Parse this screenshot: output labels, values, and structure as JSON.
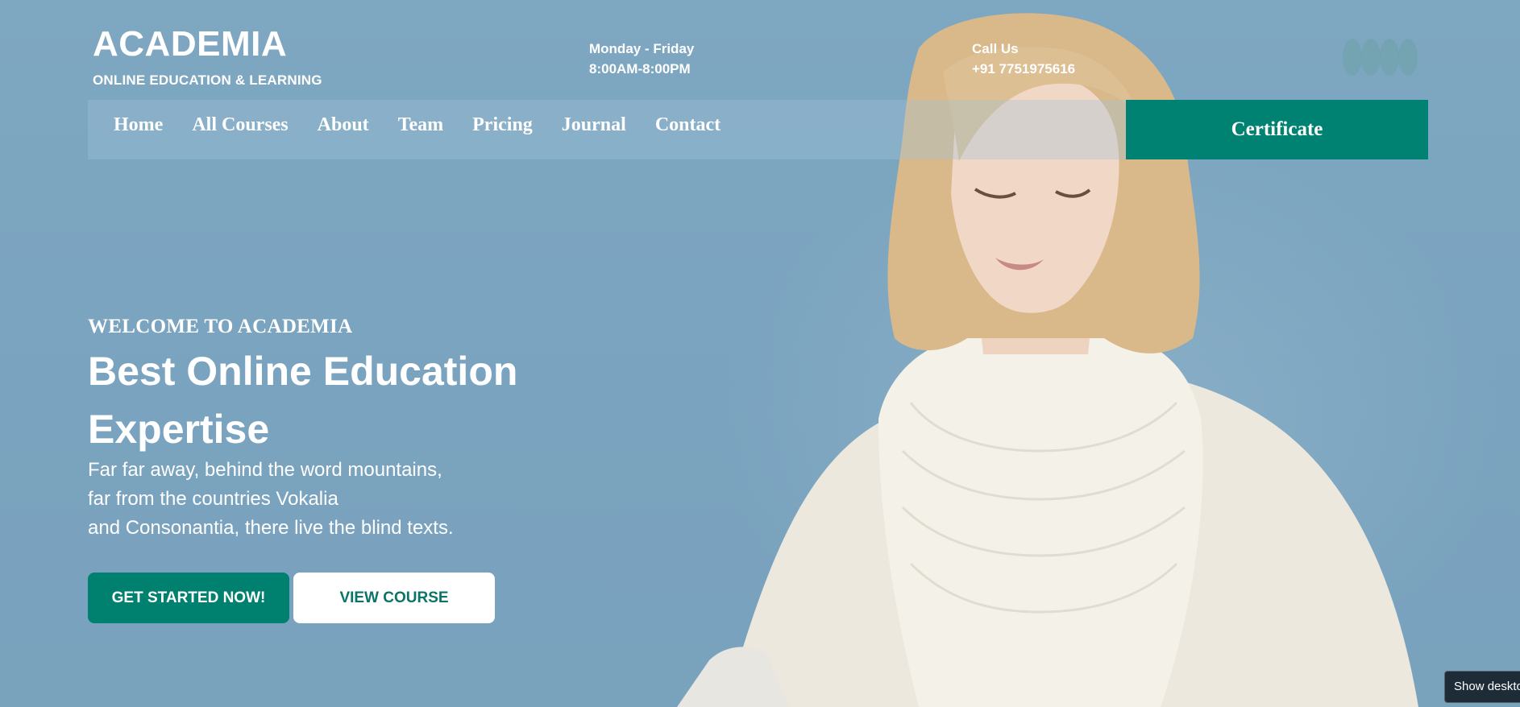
{
  "brand": {
    "title": "ACADEMIA",
    "subtitle": "ONLINE EDUCATION & LEARNING"
  },
  "header": {
    "hours_days": "Monday - Friday",
    "hours_time": "8:00AM-8:00PM",
    "call_label": "Call Us",
    "call_number": "+91 7751975616",
    "social_icons": [
      "social-icon-1",
      "social-icon-2",
      "social-icon-3",
      "social-icon-4"
    ]
  },
  "nav": {
    "items": [
      "Home",
      "All Courses",
      "About",
      "Team",
      "Pricing",
      "Journal",
      "Contact"
    ],
    "cta": "Certificate"
  },
  "hero": {
    "welcome": "WELCOME TO ACADEMIA",
    "headline": "Best Online Education Expertise",
    "lede_lines": [
      "Far far away, behind the word mountains,",
      "far from the countries Vokalia",
      "and Consonantia, there live the blind texts."
    ],
    "primary_button": "GET STARTED NOW!",
    "secondary_button": "VIEW COURSE",
    "image": "woman-reading-in-white-scarf"
  },
  "system": {
    "tooltip": "Show desktop"
  },
  "colors": {
    "background": "#7ea6c1",
    "accent": "#008272",
    "text": "#ffffff"
  }
}
